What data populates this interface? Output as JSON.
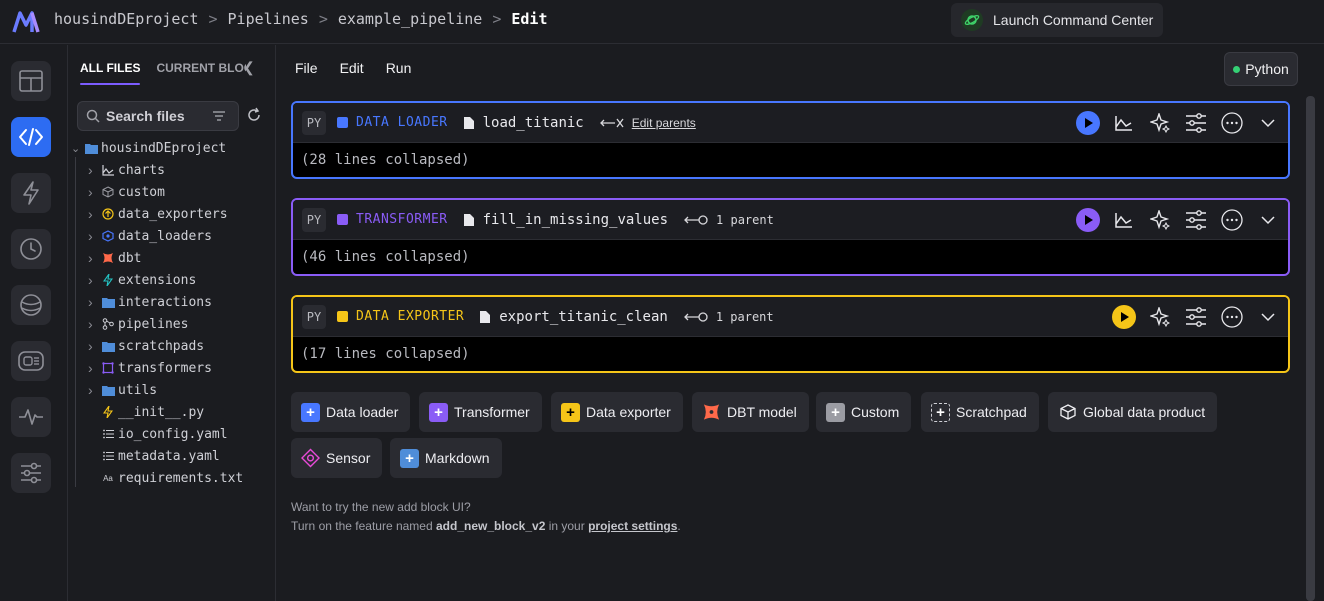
{
  "breadcrumb": {
    "project": "housindDEproject",
    "section": "Pipelines",
    "pipeline": "example_pipeline",
    "current": "Edit"
  },
  "launch": {
    "label": "Launch Command Center"
  },
  "file_panel": {
    "tabs": [
      "ALL FILES",
      "CURRENT BLOCK"
    ],
    "search_placeholder": "Search files",
    "root": "housindDEproject",
    "items": [
      {
        "label": "charts",
        "icon": "chart-icon",
        "folder": true
      },
      {
        "label": "custom",
        "icon": "cube-icon",
        "folder": true
      },
      {
        "label": "data_exporters",
        "icon": "export-icon",
        "folder": true
      },
      {
        "label": "data_loaders",
        "icon": "loader-icon",
        "folder": true
      },
      {
        "label": "dbt",
        "icon": "dbt-icon",
        "folder": true
      },
      {
        "label": "extensions",
        "icon": "bolt-icon",
        "folder": true
      },
      {
        "label": "interactions",
        "icon": "folder-icon",
        "folder": true
      },
      {
        "label": "pipelines",
        "icon": "pipeline-icon",
        "folder": true
      },
      {
        "label": "scratchpads",
        "icon": "folder-icon",
        "folder": true
      },
      {
        "label": "transformers",
        "icon": "transform-icon",
        "folder": true
      },
      {
        "label": "utils",
        "icon": "folder-icon",
        "folder": true
      },
      {
        "label": "__init__.py",
        "icon": "python-icon",
        "folder": false
      },
      {
        "label": "io_config.yaml",
        "icon": "list-icon",
        "folder": false
      },
      {
        "label": "metadata.yaml",
        "icon": "list-icon",
        "folder": false
      },
      {
        "label": "requirements.txt",
        "icon": "text-icon",
        "folder": false
      }
    ]
  },
  "menu": {
    "file": "File",
    "edit": "Edit",
    "run": "Run"
  },
  "kernel": {
    "label": "Python",
    "status_color": "#35d075"
  },
  "blocks": [
    {
      "lang": "PY",
      "type": "DATA LOADER",
      "name": "load_titanic",
      "parent_text": "Edit parents",
      "body": "(28 lines collapsed)",
      "color": "#4877ff"
    },
    {
      "lang": "PY",
      "type": "TRANSFORMER",
      "name": "fill_in_missing_values",
      "parent_text": "1 parent",
      "body": "(46 lines collapsed)",
      "color": "#8a5cf6"
    },
    {
      "lang": "PY",
      "type": "DATA EXPORTER",
      "name": "export_titanic_clean",
      "parent_text": "1 parent",
      "body": "(17 lines collapsed)",
      "color": "#f5c518"
    }
  ],
  "add_buttons": {
    "data_loader": "Data loader",
    "transformer": "Transformer",
    "data_exporter": "Data exporter",
    "dbt_model": "DBT model",
    "custom": "Custom",
    "scratchpad": "Scratchpad",
    "global_data_product": "Global data product",
    "sensor": "Sensor",
    "markdown": "Markdown"
  },
  "hint": {
    "line1": "Want to try the new add block UI?",
    "line2_prefix": "Turn on the feature named ",
    "feature": "add_new_block_v2",
    "line2_mid": " in your ",
    "link": "project settings",
    "line2_suffix": "."
  }
}
